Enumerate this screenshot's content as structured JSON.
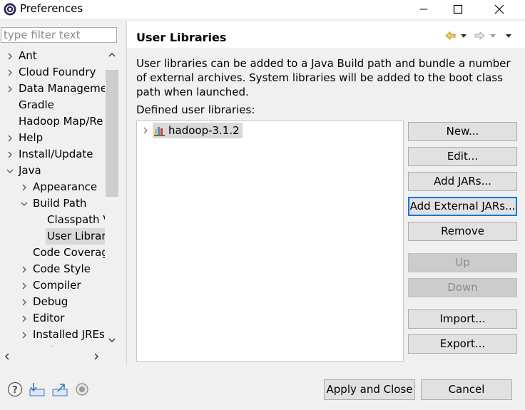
{
  "window": {
    "title": "Preferences",
    "controls": [
      "minimize",
      "maximize",
      "close"
    ]
  },
  "filter": {
    "placeholder": "type filter text",
    "value": ""
  },
  "tree": {
    "items": [
      {
        "label": "Ant",
        "level": 0,
        "expandable": true,
        "expanded": false
      },
      {
        "label": "Cloud Foundry",
        "level": 0,
        "expandable": true,
        "expanded": false
      },
      {
        "label": "Data Manageme",
        "level": 0,
        "expandable": true,
        "expanded": false
      },
      {
        "label": "Gradle",
        "level": 0,
        "expandable": false
      },
      {
        "label": "Hadoop Map/Re",
        "level": 0,
        "expandable": false
      },
      {
        "label": "Help",
        "level": 0,
        "expandable": true,
        "expanded": false
      },
      {
        "label": "Install/Update",
        "level": 0,
        "expandable": true,
        "expanded": false
      },
      {
        "label": "Java",
        "level": 0,
        "expandable": true,
        "expanded": true
      },
      {
        "label": "Appearance",
        "level": 1,
        "expandable": true,
        "expanded": false
      },
      {
        "label": "Build Path",
        "level": 1,
        "expandable": true,
        "expanded": true
      },
      {
        "label": "Classpath V",
        "level": 2,
        "expandable": false
      },
      {
        "label": "User Librar",
        "level": 2,
        "expandable": false,
        "selected": true
      },
      {
        "label": "Code Coverag",
        "level": 1,
        "expandable": false
      },
      {
        "label": "Code Style",
        "level": 1,
        "expandable": true,
        "expanded": false
      },
      {
        "label": "Compiler",
        "level": 1,
        "expandable": true,
        "expanded": false
      },
      {
        "label": "Debug",
        "level": 1,
        "expandable": true,
        "expanded": false
      },
      {
        "label": "Editor",
        "level": 1,
        "expandable": true,
        "expanded": false
      },
      {
        "label": "Installed JREs",
        "level": 1,
        "expandable": true,
        "expanded": false
      },
      {
        "label": "JUnit",
        "level": 1,
        "expandable": false
      }
    ]
  },
  "page": {
    "title": "User Libraries",
    "description": "User libraries can be added to a Java Build path and bundle a number of external archives. System libraries will be added to the boot class path when launched.",
    "defined_label": "Defined user libraries:",
    "libraries": [
      {
        "label": "hadoop-3.1.2"
      }
    ]
  },
  "buttons": {
    "new": "New...",
    "edit": "Edit...",
    "add_jars": "Add JARs...",
    "add_external_jars": "Add External JARs...",
    "remove": "Remove",
    "up": "Up",
    "down": "Down",
    "import": "Import...",
    "export": "Export..."
  },
  "footer": {
    "apply_close": "Apply and Close",
    "cancel": "Cancel"
  },
  "colors": {
    "background": "#f0f0f0",
    "selection": "#d9d9d9",
    "focus_border": "#0078d7"
  }
}
